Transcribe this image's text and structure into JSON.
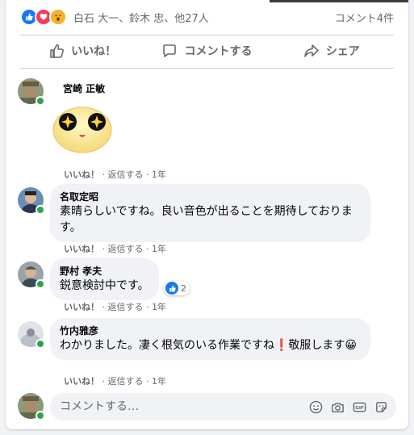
{
  "summary": {
    "names": "白石 大一、鈴木 忠、他27人",
    "comment_count": "コメント4件"
  },
  "actions": {
    "like": "いいね！",
    "comment": "コメントする",
    "share": "シェア"
  },
  "comments": [
    {
      "name": "宮崎 正敏",
      "text": "",
      "like": "いいね！",
      "reply": "返信する",
      "time": "1年"
    },
    {
      "name": "名取定昭",
      "text": "素晴らしいですね。良い音色が出ることを期待しております。",
      "like": "いいね！",
      "reply": "返信する",
      "time": "1年"
    },
    {
      "name": "野村 孝夫",
      "text": "鋭意検討中です。",
      "like": "いいね！",
      "reply": "返信する",
      "time": "1年",
      "reactions": "2"
    },
    {
      "name": "竹内雅彦",
      "text": "わかりました。凄く根気のいる作業ですね❗敬服します😀",
      "like": "いいね！",
      "reply": "返信する",
      "time": "1年"
    }
  ],
  "composer": {
    "placeholder": "コメントする…"
  },
  "colors": {
    "accent": "#1877f2",
    "online": "#31a24c",
    "bubble": "#f0f2f5"
  }
}
